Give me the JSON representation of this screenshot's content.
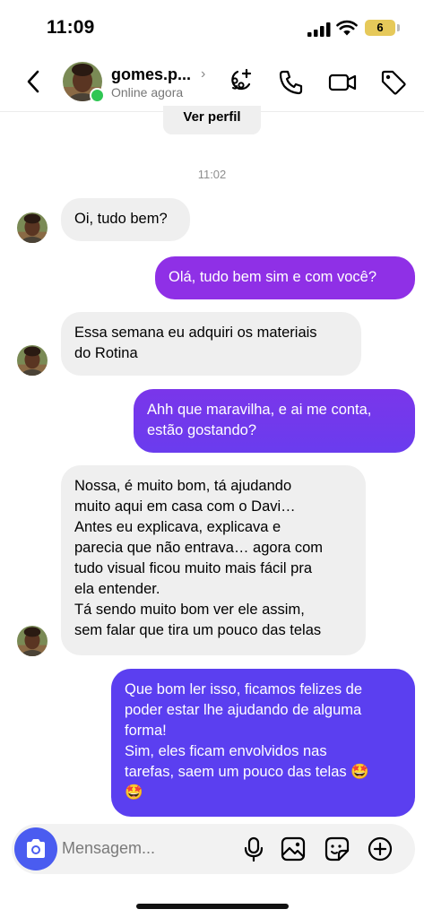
{
  "status_bar": {
    "time": "11:09",
    "battery": "6"
  },
  "header": {
    "username": "gomes.p...",
    "chevron": "›",
    "status": "Online agora",
    "icons": [
      "add-effect-icon",
      "phone-icon",
      "video-icon",
      "tag-icon"
    ]
  },
  "profile_button": "Ver perfil",
  "timestamp": "11:02",
  "messages": [
    {
      "dir": "in",
      "text": "Oi, tudo bem?"
    },
    {
      "dir": "out",
      "text": "Olá, tudo bem sim e com você?"
    },
    {
      "dir": "in",
      "text": "Essa semana eu adquiri os materiais\ndo Rotina"
    },
    {
      "dir": "out",
      "text": "Ahh que maravilha, e ai me conta,\nestão gostando?"
    },
    {
      "dir": "in",
      "text": "Nossa, é muito bom, tá ajudando\nmuito aqui em casa com o Davi…\nAntes eu explicava, explicava e\nparecia que não entrava… agora com\ntudo visual ficou muito mais fácil pra\nela entender.\nTá sendo muito bom ver ele assim,\nsem falar que tira um pouco das telas"
    },
    {
      "dir": "out",
      "text": "Que bom ler isso, ficamos felizes de\npoder estar lhe ajudando de alguma\nforma!\nSim, eles ficam envolvidos nas\ntarefas, saem um pouco das telas 🤩\n🤩"
    }
  ],
  "composer": {
    "placeholder": "Mensagem...",
    "icons": [
      "camera-icon",
      "microphone-icon",
      "image-icon",
      "sticker-icon",
      "plus-icon"
    ]
  },
  "colors": {
    "accent": "#4a5cf0",
    "online": "#2fc653",
    "gradient_top": "#9b2fe0",
    "gradient_bottom": "#5b3ff0"
  }
}
